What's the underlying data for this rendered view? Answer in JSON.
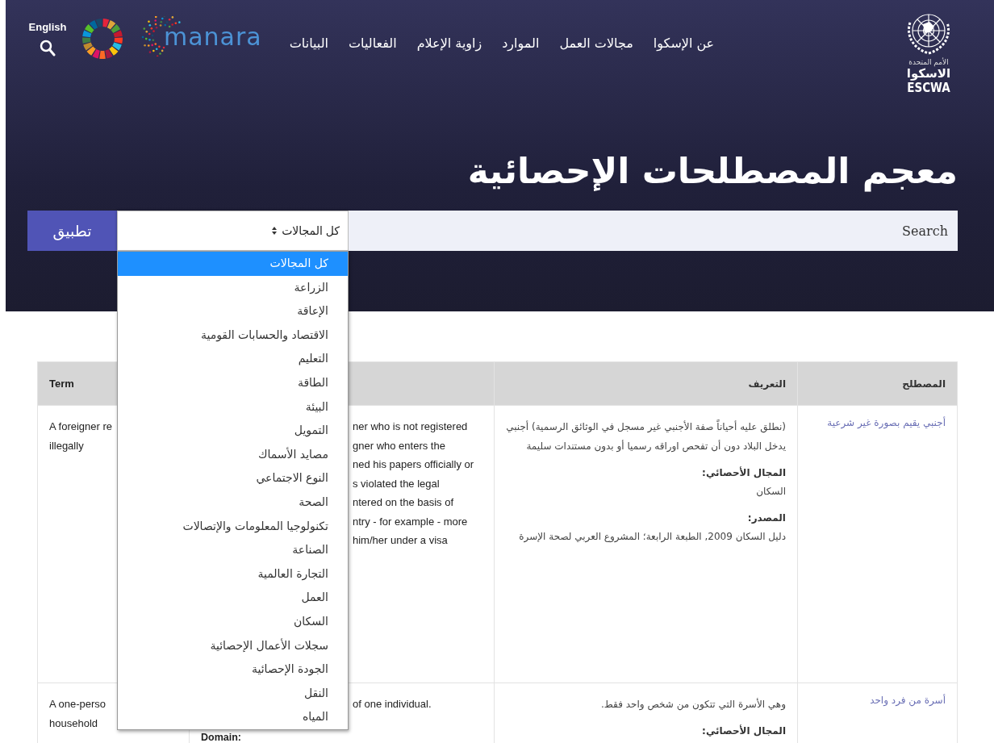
{
  "header": {
    "language_link": "English",
    "logo_text": "manara",
    "nav": [
      "عن الإسكوا",
      "مجالات العمل",
      "الموارد",
      "زاوية الإعلام",
      "الفعاليات",
      "البيانات"
    ],
    "org": {
      "line1": "الأمم المتحدة",
      "line2": "الاسكوا",
      "line3": "ESCWA"
    }
  },
  "title": "معجم المصطلحات الإحصائية",
  "search": {
    "placeholder": "Search",
    "domain_select": "كل المجالات",
    "apply_button": "تطبيق"
  },
  "domain_options": [
    {
      "label": "كل المجالات",
      "selected": true
    },
    {
      "label": "الزراعة",
      "selected": false
    },
    {
      "label": "الإعاقة",
      "selected": false
    },
    {
      "label": "الاقتصاد والحسابات القومية",
      "selected": false
    },
    {
      "label": "التعليم",
      "selected": false
    },
    {
      "label": "الطاقة",
      "selected": false
    },
    {
      "label": "البيئة",
      "selected": false
    },
    {
      "label": "التمويل",
      "selected": false
    },
    {
      "label": "مصايد الأسماك",
      "selected": false
    },
    {
      "label": "النوع الاجتماعي",
      "selected": false
    },
    {
      "label": "الصحة",
      "selected": false
    },
    {
      "label": "تكنولوجيا المعلومات والإتصالات",
      "selected": false
    },
    {
      "label": "الصناعة",
      "selected": false
    },
    {
      "label": "التجارة العالمية",
      "selected": false
    },
    {
      "label": "العمل",
      "selected": false
    },
    {
      "label": "السكان",
      "selected": false
    },
    {
      "label": "سجلات الأعمال الإحصائية",
      "selected": false
    },
    {
      "label": "الجودة الإحصائية",
      "selected": false
    },
    {
      "label": "النقل",
      "selected": false
    },
    {
      "label": "المياه",
      "selected": false
    }
  ],
  "table": {
    "columns": {
      "term_ar": "المصطلح",
      "definition_ar": "التعريف",
      "term_en": "Term"
    },
    "rows": [
      {
        "term_ar": "أجنبي يقيم بصورة غير شرعية",
        "definition_ar": [
          {
            "kind": "paragraph",
            "text": "(نطلق عليه أحياناً صفة الأجنبي غير مسجل في الوثائق الرسمية) أجنبي يدخل البلاد دون أن تفحص اوراقه رسميا أو بدون مستندات سليمة"
          },
          {
            "kind": "label",
            "text": "المجال الأحصائي:"
          },
          {
            "kind": "paragraph",
            "text": "السكان"
          },
          {
            "kind": "label",
            "text": "المصدر:"
          },
          {
            "kind": "paragraph",
            "text": "دليل السكان 2009, الطبعة الرابعة؛ المشروع العربي لصحة الإسرة"
          }
        ],
        "definition_en_visible": [
          "ner who is not registered",
          "gner who enters the",
          "ned his papers officially or",
          "s violated the legal",
          "ntered on the basis of",
          "ntry - for example - more",
          "him/her under a visa"
        ],
        "term_en": [
          "A foreigner re",
          "illegally"
        ]
      },
      {
        "term_ar": "أسرة من فرد واحد",
        "definition_ar": [
          {
            "kind": "paragraph",
            "text": "وهي الأسرة التي تتكون من شخص واحد فقط."
          },
          {
            "kind": "label",
            "text": "المجال الأحصائي:"
          }
        ],
        "definition_en_visible": [
          "of one individual."
        ],
        "definition_en_label": "Domain:",
        "term_en": [
          "A one-perso",
          "household"
        ]
      }
    ]
  }
}
